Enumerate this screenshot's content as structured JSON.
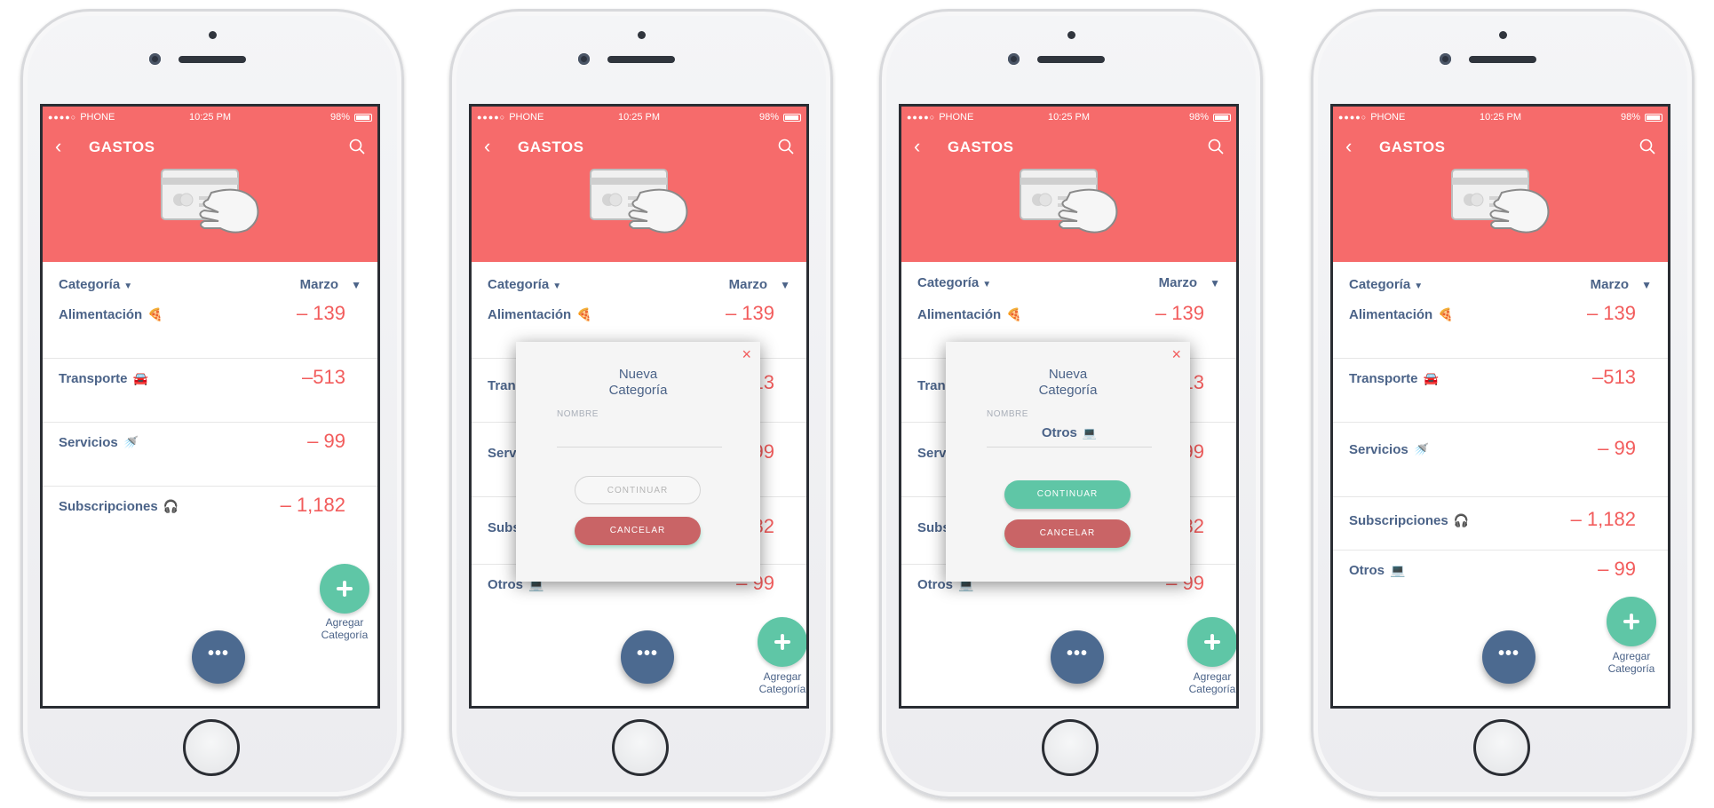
{
  "status": {
    "signal": "●●●●○",
    "carrier": "PHONE",
    "time": "10:25 PM",
    "battery": "98%"
  },
  "header": {
    "title": "GASTOS"
  },
  "filters": {
    "category": "Categoría",
    "month": "Marzo"
  },
  "categories": [
    {
      "name": "Alimentación",
      "emoji": "🍕",
      "amount": "– 139"
    },
    {
      "name": "Transporte",
      "emoji": "🚘",
      "amount": "–513"
    },
    {
      "name": "Servicios",
      "emoji": "🚿",
      "amount": "– 99"
    },
    {
      "name": "Subscripciones",
      "emoji": "🎧",
      "amount": "– 1,182"
    },
    {
      "name": "Otros",
      "emoji": "💻",
      "amount": "– 99"
    }
  ],
  "add_button": {
    "label_line1": "Agregar",
    "label_line2": "Categoría"
  },
  "more_button": {
    "label": "•••"
  },
  "modal": {
    "close": "×",
    "title_line1": "Nueva",
    "title_line2": "Categoría",
    "field_label": "NOMBRE",
    "field_value_empty": "",
    "field_value_filled": "Otros",
    "field_value_emoji": "💻",
    "continue_label": "CONTINUAR",
    "cancel_label": "CANCELAR"
  },
  "colors": {
    "header": "#f66b6b",
    "text_primary": "#4b6388",
    "amount": "#f25c5c",
    "add_fab": "#5fc6a6",
    "more_fab": "#4c6a90",
    "cancel": "#c96466"
  }
}
